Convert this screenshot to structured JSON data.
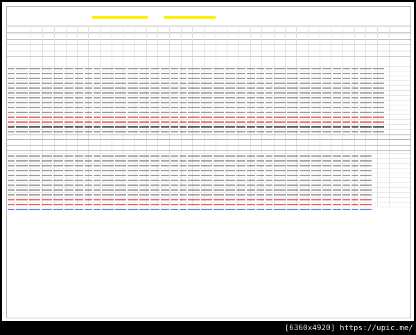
{
  "sheet": {
    "highlight_label_1": "",
    "highlight_label_2": "",
    "header_lines": [
      "",
      "",
      ""
    ]
  },
  "footer": {
    "badge_text": "[6360x4920] https://upic.me/"
  },
  "colors": {
    "page_bg": "#ffffff",
    "frame": "#000000",
    "highlight": "#fff000",
    "red_values": "#d33333",
    "blue_values": "#3a5fd6"
  }
}
